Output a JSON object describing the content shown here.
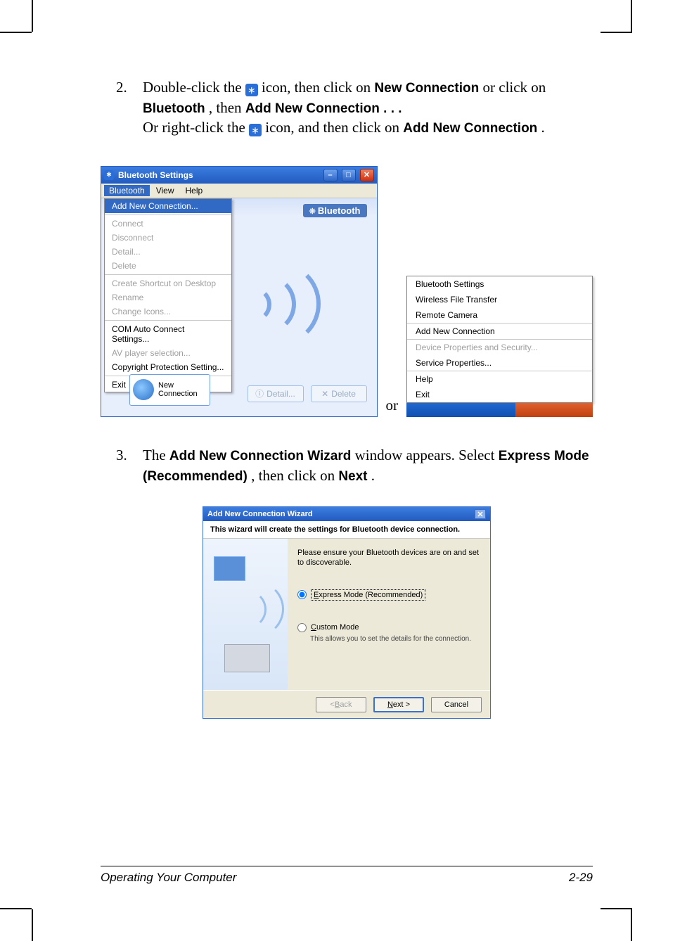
{
  "step2": {
    "num": "2.",
    "t1": "Double-click the ",
    "t2": " icon, then click on ",
    "b1": "New Connection",
    "t3": " or click on",
    "b2": "Bluetooth",
    "t4": ", then ",
    "b3": "Add New Connection . . .",
    "t5": "Or right-click the ",
    "t6": " icon, and then click on ",
    "b4": "Add New Connection",
    "t7": "."
  },
  "win1": {
    "title": "Bluetooth Settings",
    "menu": {
      "bluetooth": "Bluetooth",
      "view": "View",
      "help": "Help"
    },
    "brand": "Bluetooth",
    "dd": {
      "addnew": "Add New Connection...",
      "connect": "Connect",
      "disconnect": "Disconnect",
      "detail": "Detail...",
      "delete": "Delete",
      "shortcut": "Create Shortcut on Desktop",
      "rename": "Rename",
      "icons": "Change Icons...",
      "com": "COM Auto Connect Settings...",
      "av": "AV player selection...",
      "copy": "Copyright Protection Setting...",
      "exit": "Exit"
    },
    "newconn": "New\nConnection",
    "detail_btn": "Detail...",
    "delete_btn": "Delete"
  },
  "or": "or",
  "ctx": {
    "bts": "Bluetooth Settings",
    "wft": "Wireless File Transfer",
    "rc": "Remote Camera",
    "anc": "Add New Connection",
    "dps": "Device Properties and Security...",
    "sp": "Service Properties...",
    "help": "Help",
    "exit": "Exit"
  },
  "step3": {
    "num": "3.",
    "t1": "The ",
    "b1": "Add New Connection Wizard",
    "t2": " window appears. Select ",
    "b2": "Express Mode (Recommended)",
    "t3": ", then click on ",
    "b3": "Next",
    "t4": "."
  },
  "wizard": {
    "title": "Add New Connection Wizard",
    "banner": "This wizard will create the settings for Bluetooth device connection.",
    "hint": "Please ensure your Bluetooth devices are on and set to discoverable.",
    "exp_u": "E",
    "exp_rest": "xpress Mode (Recommended)",
    "cus_u": "C",
    "cus_rest": "ustom Mode",
    "cus_sub": "This allows you to set the details for the connection.",
    "back_u": "B",
    "back": "< Back",
    "next": "Next >",
    "next_u": "N",
    "cancel": "Cancel"
  },
  "footer": {
    "left": "Operating Your Computer",
    "right": "2-29"
  }
}
